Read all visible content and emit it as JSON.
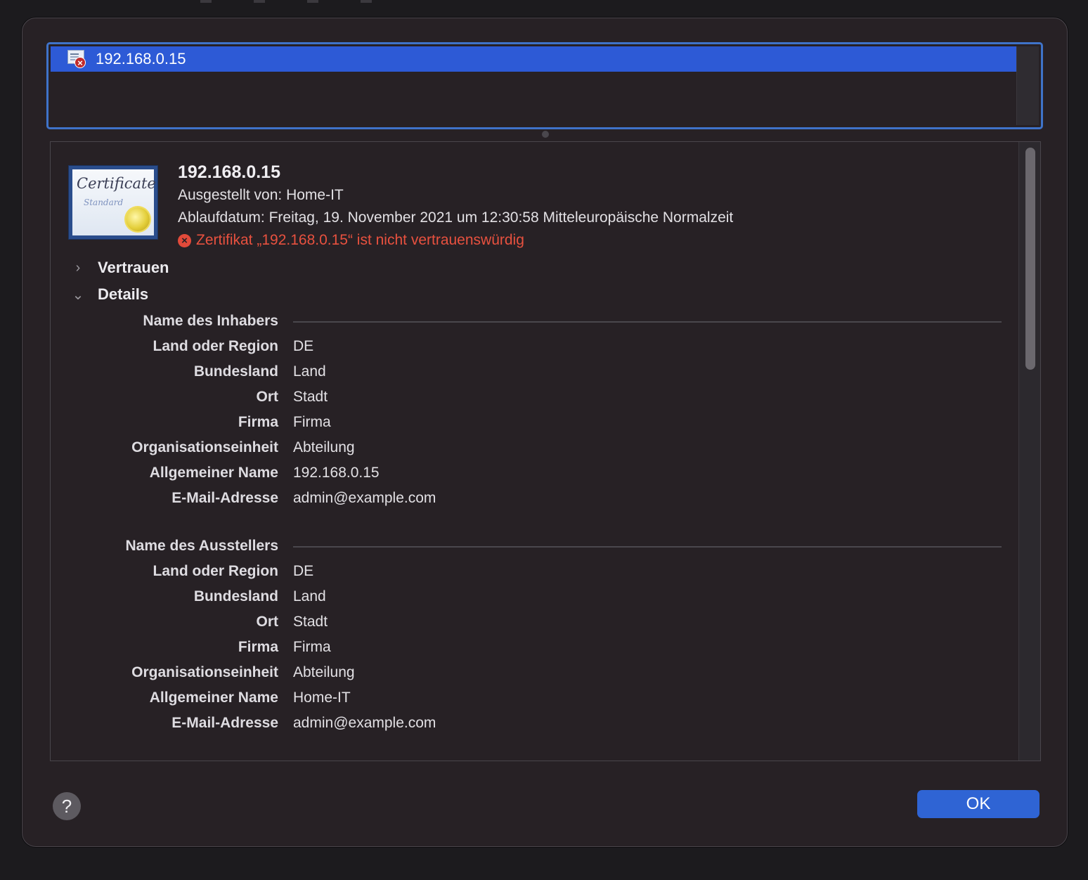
{
  "cert_list": {
    "items": [
      {
        "label": "192.168.0.15"
      }
    ]
  },
  "header": {
    "name": "192.168.0.15",
    "issued_by": "Ausgestellt von: Home-IT",
    "expiry": "Ablaufdatum: Freitag, 19. November 2021 um 12:30:58 Mitteleuropäische Normalzeit",
    "error": "Zertifikat „192.168.0.15“ ist nicht vertrauenswürdig",
    "icon_title": "Certificate",
    "icon_subtitle": "Standard"
  },
  "sections": {
    "trust_label": "Vertrauen",
    "details_label": "Details"
  },
  "subject": {
    "header": "Name des Inhabers",
    "rows": [
      {
        "key": "Land oder Region",
        "value": "DE"
      },
      {
        "key": "Bundesland",
        "value": "Land"
      },
      {
        "key": "Ort",
        "value": "Stadt"
      },
      {
        "key": "Firma",
        "value": "Firma"
      },
      {
        "key": "Organisationseinheit",
        "value": "Abteilung"
      },
      {
        "key": "Allgemeiner Name",
        "value": "192.168.0.15"
      },
      {
        "key": "E-Mail-Adresse",
        "value": "admin@example.com"
      }
    ]
  },
  "issuer": {
    "header": "Name des Ausstellers",
    "rows": [
      {
        "key": "Land oder Region",
        "value": "DE"
      },
      {
        "key": "Bundesland",
        "value": "Land"
      },
      {
        "key": "Ort",
        "value": "Stadt"
      },
      {
        "key": "Firma",
        "value": "Firma"
      },
      {
        "key": "Organisationseinheit",
        "value": "Abteilung"
      },
      {
        "key": "Allgemeiner Name",
        "value": "Home-IT"
      },
      {
        "key": "E-Mail-Adresse",
        "value": "admin@example.com"
      }
    ]
  },
  "buttons": {
    "help": "?",
    "ok": "OK"
  },
  "colors": {
    "accent": "#2f64d4",
    "selection": "#2d5ad6",
    "error": "#e8513f",
    "background": "#272125"
  },
  "icons": {
    "list_item": "certificate-error-icon",
    "header": "certificate-icon",
    "error": "error-x-icon",
    "trust": "chevron-right-icon",
    "details": "chevron-down-icon"
  }
}
